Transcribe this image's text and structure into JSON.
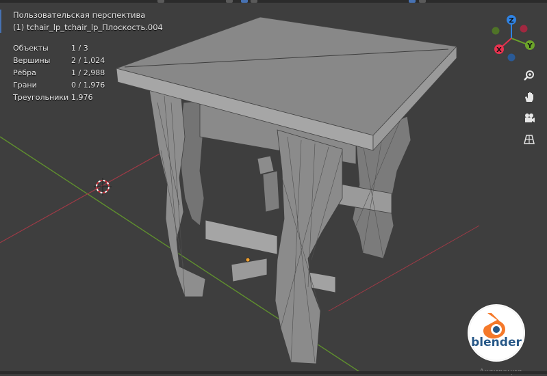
{
  "viewport": {
    "view_name": "Пользовательская перспектива",
    "object_name": "(1) tchair_lp_tchair_lp_Плоскость.004"
  },
  "stats": [
    {
      "label": "Объекты",
      "value": "1 / 3"
    },
    {
      "label": "Вершины",
      "value": "2 / 1,024"
    },
    {
      "label": "Рёбра",
      "value": "1 / 2,988"
    },
    {
      "label": "Грани",
      "value": "0 / 1,976"
    },
    {
      "label": "Треугольники",
      "value": "1,976"
    }
  ],
  "gizmo": {
    "z_label": "Z",
    "y_label": "Y",
    "x_label": "X",
    "colors": {
      "x": "#e8324f",
      "y": "#6ba32a",
      "z": "#2f83e4"
    }
  },
  "nav_icons": [
    "zoom-icon",
    "hand-pan-icon",
    "camera-icon",
    "grid-perspective-icon"
  ],
  "logo": {
    "text": "blender",
    "colors": {
      "ring": "#f5792a",
      "circle": "#265787"
    }
  },
  "watermark": "Активация"
}
